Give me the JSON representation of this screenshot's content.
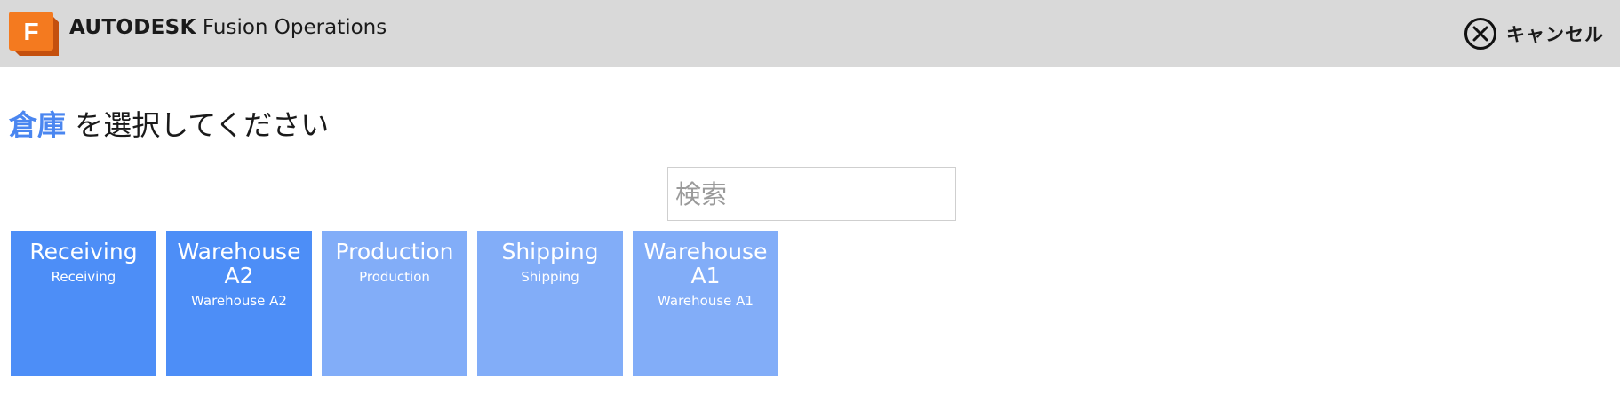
{
  "app": {
    "brand_strong": "AUTODESK",
    "brand_rest": " Fusion Operations",
    "logo_letter": "F",
    "logo_icon": "fusion-logo-icon"
  },
  "header": {
    "cancel_label": "キャンセル",
    "cancel_icon": "close-circle-icon"
  },
  "prompt": {
    "entity": "倉庫",
    "text": " を選択してください"
  },
  "search": {
    "placeholder": "検索",
    "value": ""
  },
  "colors": {
    "accent": "#4a86f0",
    "tile_strong": "#4d8ef7",
    "tile_light": "#82adf8",
    "logo_orange": "#f47a1f",
    "logo_dark": "#c4500e"
  },
  "warehouses": [
    {
      "title": "Receiving",
      "subtitle": "Receiving",
      "color": "#4d8ef7"
    },
    {
      "title": "Warehouse A2",
      "subtitle": "Warehouse A2",
      "color": "#4d8ef7"
    },
    {
      "title": "Production",
      "subtitle": "Production",
      "color": "#82adf8"
    },
    {
      "title": "Shipping",
      "subtitle": "Shipping",
      "color": "#82adf8"
    },
    {
      "title": "Warehouse A1",
      "subtitle": "Warehouse A1",
      "color": "#82adf8"
    }
  ]
}
